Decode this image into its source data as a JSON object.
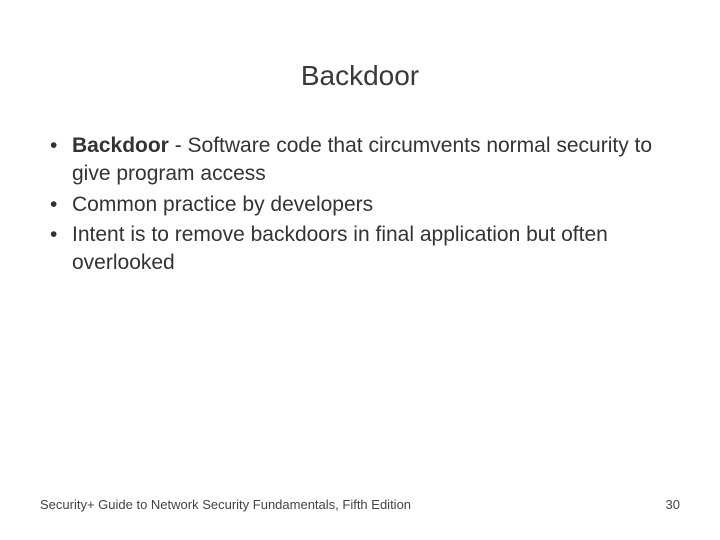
{
  "title": "Backdoor",
  "bullets": [
    {
      "term": "Backdoor",
      "rest": " - Software code that circumvents normal security to give program access"
    },
    {
      "term": "",
      "rest": "Common practice by developers"
    },
    {
      "term": "",
      "rest": "Intent is to remove backdoors in final application but often overlooked"
    }
  ],
  "footer": {
    "source": "Security+ Guide to Network Security Fundamentals, Fifth Edition",
    "page": "30"
  }
}
